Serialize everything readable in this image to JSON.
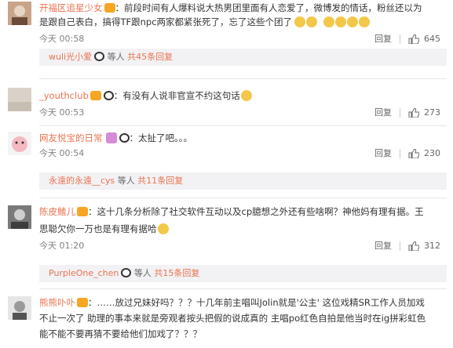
{
  "comments": [
    {
      "user": "开福区追星少女",
      "text_line1": "：前段时间有人爆料说大热男团里面有人恋爱了，微博发的情话，粉丝还以为",
      "text_line2": "是跟自己表白，搞得TF跟npc两家都紧张死了，忘了这些个团了",
      "time": "00:58",
      "reply_label": "回复",
      "likes": "645",
      "sub": {
        "user": "wuli光小爱",
        "more": "等人",
        "count": "共45条回复"
      }
    },
    {
      "user": "_youthclub",
      "text_line1": "：有没有人说非官宣不约这句话",
      "time": "00:53",
      "reply_label": "回复",
      "likes": "273"
    },
    {
      "user": "网友悦宝的日常",
      "text_line1": "：太扯了吧。。。",
      "time": "00:54",
      "reply_label": "回复",
      "likes": "230",
      "sub": {
        "user": "永遠的永遠__cys",
        "more": "等人",
        "count": "共11条回复"
      }
    },
    {
      "user": "陈皮鳍儿",
      "text_line1": "：这十几条分析除了社交软件互动以及cp臆想之外还有些啥啊？神他妈有理有据。王",
      "text_line2": "思聪欠你一万也是有理有据哈",
      "time": "01:20",
      "reply_label": "回复",
      "likes": "312",
      "sub": {
        "user": "PurpleOne_chen",
        "more": "等人",
        "count": "共15条回复"
      }
    },
    {
      "user": "熊熊卟卟",
      "text_line1": "：……放过兄妹好吗？？？十几年前主唱叫Jolin就是'公主' 这位戏精SR工作人员加戏",
      "text_line2": "不止一次了 助理的事本来就是旁观者按头把假的说成真的 主唱po红色自拍是他当时在ig拼彩虹色",
      "text_line3": "能不能不要再猜不要给他们加戏了？？？"
    }
  ],
  "time_prefix": "今天",
  "colors": {
    "accent": "#eb7350",
    "meta": "#808080",
    "reply_bg": "#f2f2f5"
  }
}
